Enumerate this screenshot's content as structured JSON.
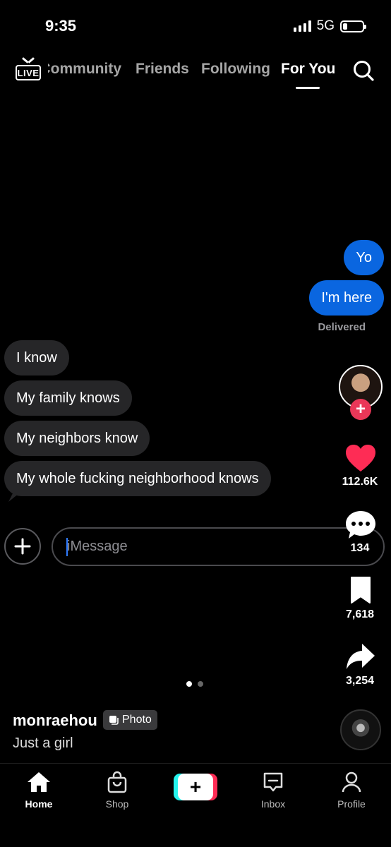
{
  "status_bar": {
    "time": "9:35",
    "network": "5G"
  },
  "top_nav": {
    "live_label": "LIVE",
    "tabs": [
      {
        "label": "Community"
      },
      {
        "label": "Friends"
      },
      {
        "label": "Following"
      },
      {
        "label": "For You",
        "active": true
      }
    ]
  },
  "conversation": {
    "outgoing": [
      "Yo",
      "I'm here"
    ],
    "status": "Delivered",
    "incoming": [
      "I know",
      "My family knows",
      "My neighbors know",
      "My whole fucking neighborhood knows"
    ],
    "input_placeholder": "iMessage"
  },
  "actions": {
    "likes": "112.6K",
    "comments": "134",
    "saves": "7,618",
    "shares": "3,254"
  },
  "post": {
    "username": "monraehou",
    "badge": "Photo",
    "caption": "Just a girl"
  },
  "bottom_nav": [
    "Home",
    "Shop",
    "Inbox",
    "Profile"
  ],
  "colors": {
    "outgoing_bubble": "#0a66e0",
    "incoming_bubble": "#262628",
    "like": "#fe2c55"
  }
}
